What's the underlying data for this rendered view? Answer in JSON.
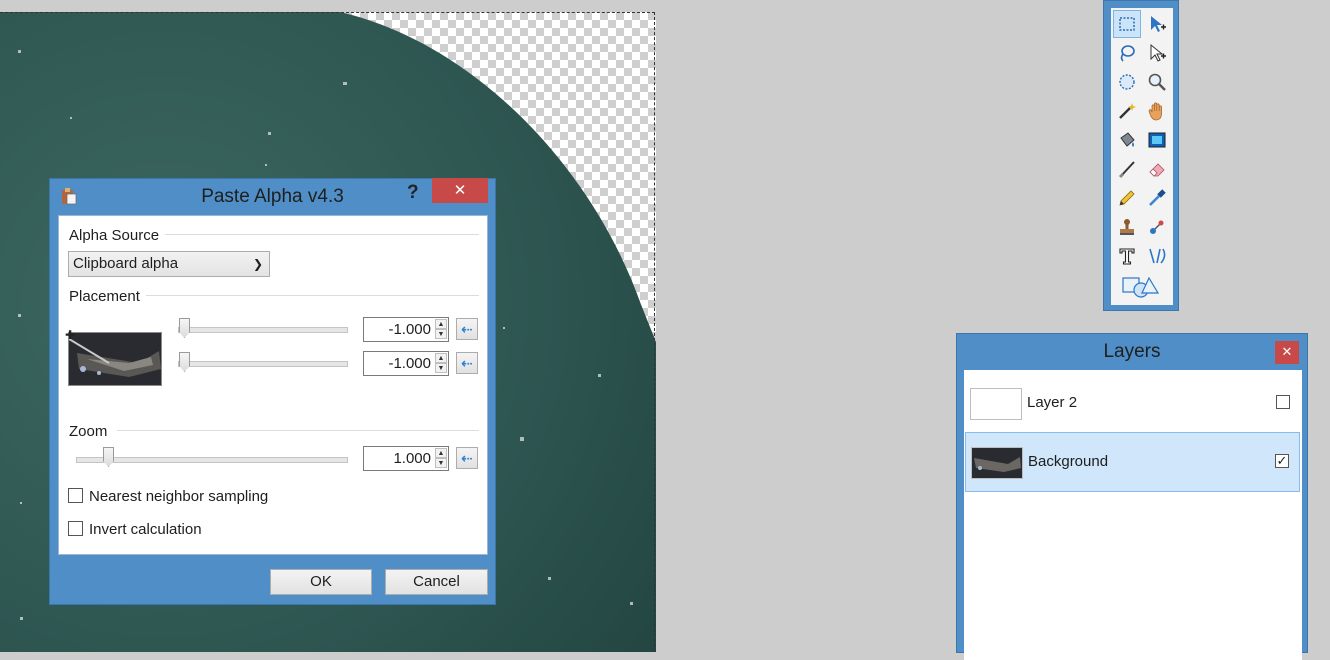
{
  "canvas": {
    "description_colors": {
      "planet": "#2e5651",
      "background": "#cdcdcd"
    }
  },
  "paste_alpha_dialog": {
    "title": "Paste Alpha v4.3",
    "help_label": "?",
    "close_label": "✕",
    "alpha_source": {
      "group_label": "Alpha Source",
      "selected": "Clipboard alpha"
    },
    "placement": {
      "group_label": "Placement",
      "x_value": "-1.000",
      "y_value": "-1.000"
    },
    "zoom": {
      "group_label": "Zoom",
      "value": "1.000"
    },
    "options": {
      "nearest_neighbor_label": "Nearest neighbor sampling",
      "nearest_neighbor_checked": false,
      "invert_label": "Invert calculation",
      "invert_checked": false
    },
    "ok_label": "OK",
    "cancel_label": "Cancel"
  },
  "tools_palette": {
    "tools": [
      "rectangle-select",
      "move-selected-pixels",
      "lasso-select",
      "move-selection",
      "ellipse-select",
      "zoom",
      "magic-wand",
      "pan",
      "paint-bucket",
      "gradient",
      "paintbrush",
      "eraser",
      "pencil",
      "color-picker",
      "clone-stamp",
      "recolor",
      "text",
      "line-curve",
      "shapes"
    ],
    "selected": "rectangle-select"
  },
  "layers_window": {
    "title": "Layers",
    "close_label": "✕",
    "layers": [
      {
        "name": "Layer 2",
        "visible": false
      },
      {
        "name": "Background",
        "visible": true
      }
    ],
    "selected_layer": "Background"
  }
}
